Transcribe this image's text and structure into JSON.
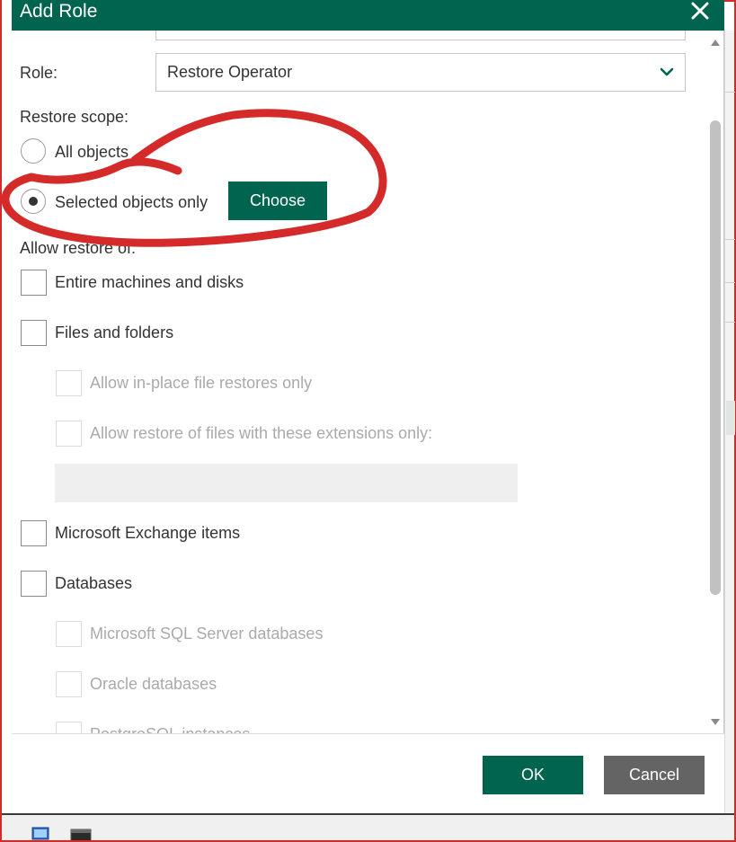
{
  "dialog": {
    "title": "Add Role",
    "role_label": "Role:",
    "role_value": "Restore Operator",
    "restore_scope_label": "Restore scope:",
    "scope_options": [
      {
        "label": "All objects",
        "selected": false
      },
      {
        "label": "Selected objects only",
        "selected": true
      }
    ],
    "choose_label": "Choose",
    "allow_restore_label": "Allow restore of:",
    "items": [
      {
        "label": "Entire machines and disks",
        "checked": false,
        "disabled": false
      },
      {
        "label": "Files and folders",
        "checked": false,
        "disabled": false
      },
      {
        "label": "Allow in-place file restores only",
        "checked": false,
        "disabled": true
      },
      {
        "label": "Allow restore of files with these extensions only:",
        "checked": false,
        "disabled": true
      },
      {
        "label": "Microsoft Exchange items",
        "checked": false,
        "disabled": false
      },
      {
        "label": "Databases",
        "checked": false,
        "disabled": false
      },
      {
        "label": "Microsoft SQL Server databases",
        "checked": false,
        "disabled": true
      },
      {
        "label": "Oracle databases",
        "checked": false,
        "disabled": true
      },
      {
        "label": "PostgreSQL instances",
        "checked": false,
        "disabled": true
      }
    ],
    "ok_label": "OK",
    "cancel_label": "Cancel"
  },
  "colors": {
    "accent": "#00644f",
    "cancel": "#646464",
    "annotation": "#d42a2a",
    "disabled_text": "#aaaaaa"
  },
  "icons": {
    "close": "close-icon",
    "dropdown": "chevron-down-icon",
    "scroll_up": "scroll-up-arrow-icon",
    "scroll_down": "scroll-down-arrow-icon",
    "taskbar_1": "computer-icon",
    "taskbar_2": "terminal-icon"
  }
}
